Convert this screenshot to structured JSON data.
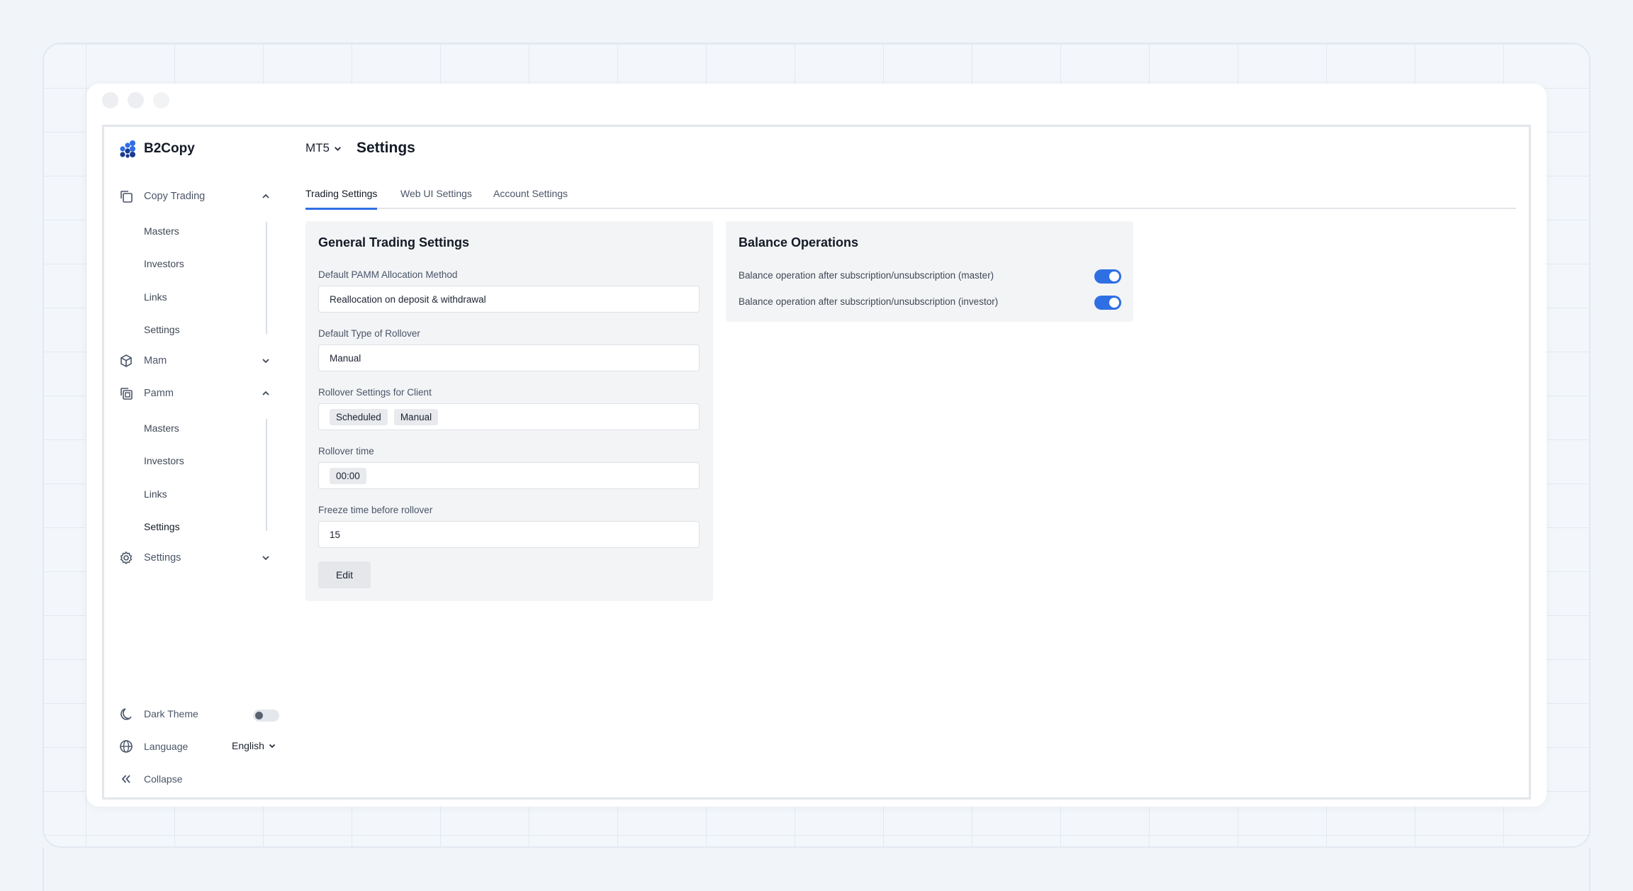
{
  "app": {
    "brand": "B2Copy"
  },
  "window": {
    "dot_colors": [
      "#eceef1",
      "#eceef1",
      "#f2f3f5"
    ]
  },
  "sidebar": {
    "groups": [
      {
        "label": "Copy Trading",
        "icon": "copy-icon",
        "expanded": true,
        "items": [
          "Masters",
          "Investors",
          "Links",
          "Settings"
        ]
      },
      {
        "label": "Mam",
        "icon": "box-icon",
        "expanded": false
      },
      {
        "label": "Pamm",
        "icon": "copy-stack-icon",
        "expanded": true,
        "items": [
          "Masters",
          "Investors",
          "Links",
          "Settings"
        ],
        "active_item": "Settings"
      },
      {
        "label": "Settings",
        "icon": "gear-icon",
        "expanded": false
      }
    ],
    "bottom": {
      "dark_theme_label": "Dark Theme",
      "dark_theme_on": false,
      "language_label": "Language",
      "language_value": "English",
      "collapse_label": "Collapse"
    }
  },
  "header": {
    "server": "MT5",
    "title": "Settings"
  },
  "tabs": [
    "Trading Settings",
    "Web UI Settings",
    "Account Settings"
  ],
  "active_tab": "Trading Settings",
  "general": {
    "title": "General Trading Settings",
    "allocation_label": "Default PAMM Allocation Method",
    "allocation_value": "Reallocation on deposit & withdrawal",
    "rollover_type_label": "Default Type of Rollover",
    "rollover_type_value": "Manual",
    "client_rollover_label": "Rollover Settings for Client",
    "client_rollover_values": [
      "Scheduled",
      "Manual"
    ],
    "rollover_time_label": "Rollover time",
    "rollover_time_value": "00:00",
    "freeze_label": "Freeze time before rollover",
    "freeze_value": "15",
    "edit_label": "Edit"
  },
  "balance": {
    "title": "Balance Operations",
    "rows": [
      {
        "label": "Balance operation after subscription/unsubscription (master)",
        "enabled": true
      },
      {
        "label": "Balance operation after subscription/unsubscription (investor)",
        "enabled": true
      }
    ]
  },
  "colors": {
    "accent": "#2f6fe4",
    "brand_blue": "#2f6fe4",
    "brand_navy": "#1a3a8f"
  }
}
